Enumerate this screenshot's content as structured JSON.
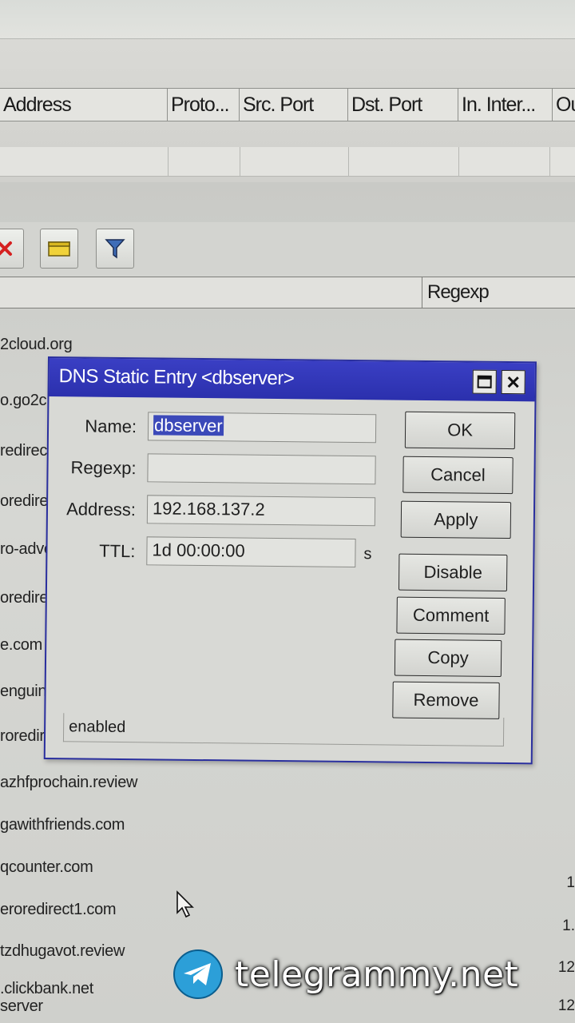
{
  "firewall_table": {
    "columns": [
      "Address",
      "Proto...",
      "Src. Port",
      "Dst. Port",
      "In. Inter...",
      "Ou"
    ]
  },
  "dns_list": {
    "regexp_header": "Regexp",
    "rows": [
      "2cloud.org",
      "o.go2c",
      "redirec",
      "oredirec",
      "ro-adve",
      "oredirect",
      "e.com",
      "enguin.pe",
      "roredirec",
      "azhfprochain.review",
      "gawithfriends.com",
      "qcounter.com",
      "eroredirect1.com",
      "tzdhugavot.review",
      ".clickbank.net",
      "server"
    ],
    "right_numbers": [
      "1",
      "1.",
      "12",
      "12"
    ]
  },
  "dialog": {
    "title": "DNS Static Entry <dbserver>",
    "fields": {
      "name_label": "Name:",
      "name_value": "dbserver",
      "regexp_label": "Regexp:",
      "regexp_value": "",
      "address_label": "Address:",
      "address_value": "192.168.137.2",
      "ttl_label": "TTL:",
      "ttl_value": "1d 00:00:00",
      "ttl_unit": "s"
    },
    "buttons": {
      "ok": "OK",
      "cancel": "Cancel",
      "apply": "Apply",
      "disable": "Disable",
      "comment": "Comment",
      "copy": "Copy",
      "remove": "Remove"
    },
    "status": "enabled"
  },
  "watermark": {
    "text": "telegrammy.net"
  },
  "colors": {
    "titlebar": "#2b30ad",
    "selection": "#3b49b9",
    "window_bg": "#d8d9d5"
  },
  "icons": [
    "remove-icon",
    "note-icon",
    "filter-icon",
    "maximize-icon",
    "close-icon",
    "telegram-icon",
    "mouse-cursor-icon"
  ]
}
